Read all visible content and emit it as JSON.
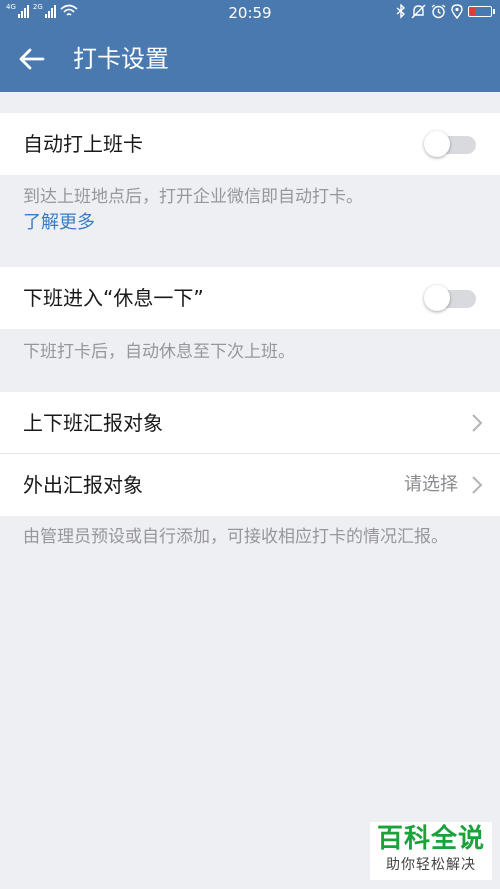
{
  "status_bar": {
    "network_1": "4G",
    "network_2": "2G",
    "time": "20:59",
    "battery_color": "#e53935"
  },
  "nav": {
    "back_icon": "arrow-left-icon",
    "title": "打卡设置",
    "background": "#4a79b0"
  },
  "auto_clock_in": {
    "label": "自动打上班卡",
    "enabled": false,
    "hint": "到达上班地点后，打开企业微信即自动打卡。",
    "link": "了解更多"
  },
  "rest_after_clock_out": {
    "label": "下班进入“休息一下”",
    "enabled": false,
    "hint": "下班打卡后，自动休息至下次上班。"
  },
  "report": {
    "items": [
      {
        "label": "上下班汇报对象",
        "value": ""
      },
      {
        "label": "外出汇报对象",
        "value": "请选择"
      }
    ],
    "hint": "由管理员预设或自行添加，可接收相应打卡的情况汇报。"
  },
  "watermark": {
    "main": "百科全说",
    "sub": "助你轻松解决"
  }
}
